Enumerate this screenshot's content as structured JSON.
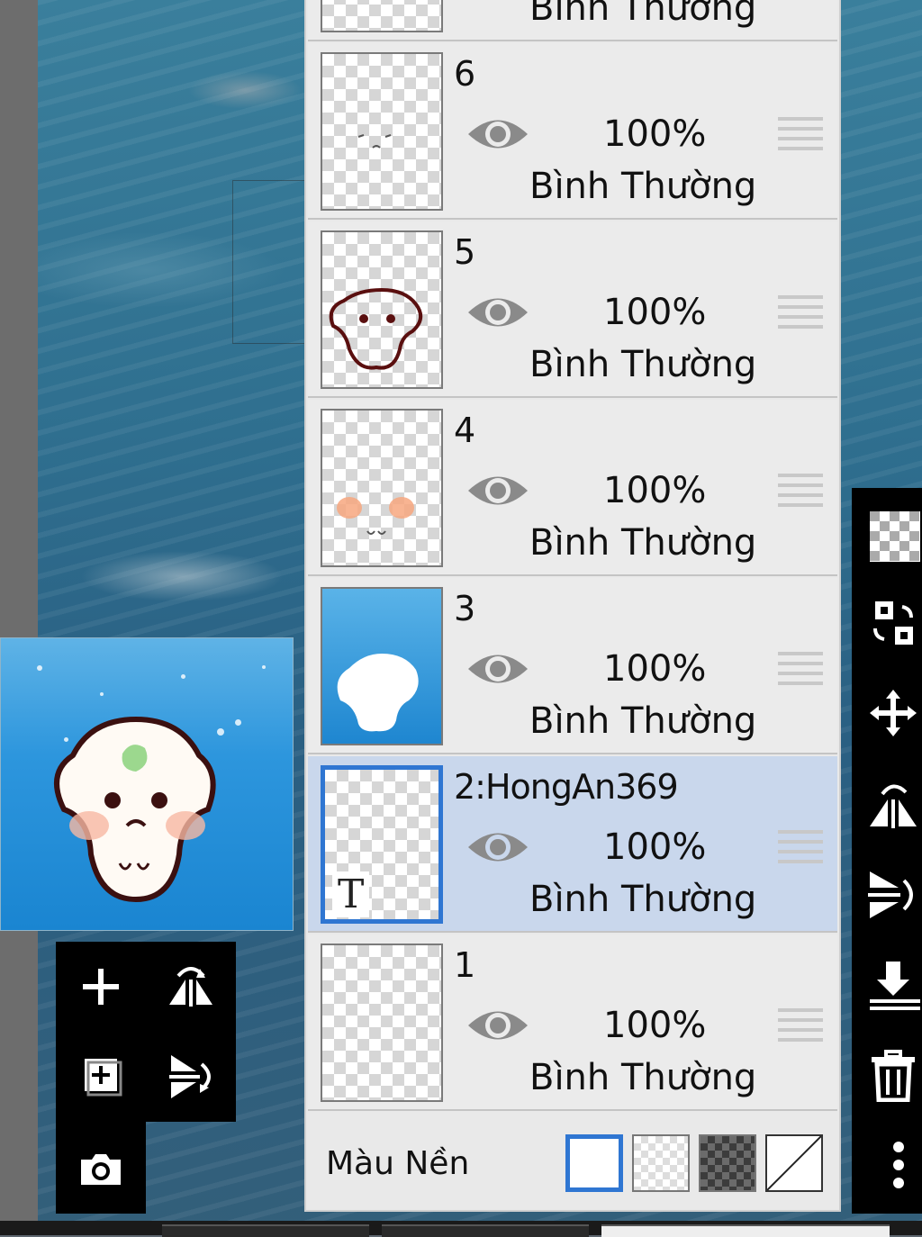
{
  "layers": [
    {
      "name": "6",
      "opacity": "100%",
      "blend": "Bình Thường"
    },
    {
      "name": "5",
      "opacity": "100%",
      "blend": "Bình Thường"
    },
    {
      "name": "4",
      "opacity": "100%",
      "blend": "Bình Thường"
    },
    {
      "name": "3",
      "opacity": "100%",
      "blend": "Bình Thường"
    },
    {
      "name": "2:HongAn369",
      "opacity": "100%",
      "blend": "Bình Thường",
      "selected": true,
      "text_badge": "T"
    },
    {
      "name": "1",
      "opacity": "100%",
      "blend": "Bình Thường"
    }
  ],
  "top_partial_layer": {
    "blend": "Bình Thường"
  },
  "background_row": {
    "label": "Màu Nền"
  },
  "colors": {
    "selected_border": "#2f76d2",
    "selected_row": "#c9d7ec",
    "panel": "#e9e9e9",
    "toolbar": "#000000"
  },
  "left_toolbar_icons": [
    "add-layer-icon",
    "flip-horizontal-icon",
    "duplicate-layer-icon",
    "flip-vertical-icon",
    "camera-icon"
  ],
  "right_toolbar_icons": [
    "transparency-icon",
    "swap-layer-icon",
    "move-icon",
    "flip-horizontal-icon",
    "flip-vertical-icon",
    "merge-down-icon",
    "trash-icon",
    "more-icon"
  ]
}
